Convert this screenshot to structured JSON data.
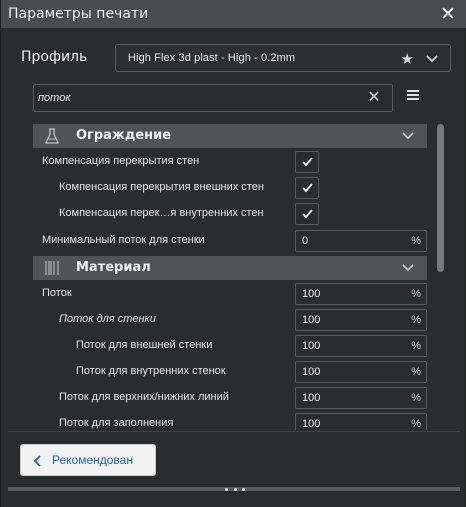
{
  "window": {
    "title": "Параметры печати"
  },
  "profile": {
    "label": "Профиль",
    "value": "High Flex 3d plast - High - 0.2mm"
  },
  "search": {
    "value": "поток"
  },
  "categories": [
    {
      "label": "Ограждение",
      "icon": "wall-shell-icon"
    },
    {
      "label": "Материал",
      "icon": "material-spool-icon"
    }
  ],
  "settings": [
    {
      "label": "Компенсация перекрытия стен",
      "type": "checkbox",
      "checked": true
    },
    {
      "label": "Компенсация перекрытия внешних стен",
      "type": "checkbox",
      "checked": true
    },
    {
      "label": "Компенсация перек…я внутренних стен",
      "type": "checkbox",
      "checked": true
    },
    {
      "label": "Минимальный поток для стенки",
      "type": "number",
      "value": "0",
      "unit": "%"
    },
    {
      "label": "Поток",
      "type": "number",
      "value": "100",
      "unit": "%"
    },
    {
      "label": "Поток для стенки",
      "type": "number",
      "value": "100",
      "unit": "%"
    },
    {
      "label": "Поток для внешней стенки",
      "type": "number",
      "value": "100",
      "unit": "%"
    },
    {
      "label": "Поток для внутренних стенок",
      "type": "number",
      "value": "100",
      "unit": "%"
    },
    {
      "label": "Поток для верхних/нижних линий",
      "type": "number",
      "value": "100",
      "unit": "%"
    },
    {
      "label": "Поток для заполнения",
      "type": "number",
      "value": "100",
      "unit": "%"
    }
  ],
  "footer": {
    "recommended_label": "Рекомендован"
  },
  "colors": {
    "background": "#2b2c2e",
    "titlebar": "#4a4c4f",
    "category": "#515356",
    "accent_text": "#2a60b6"
  }
}
